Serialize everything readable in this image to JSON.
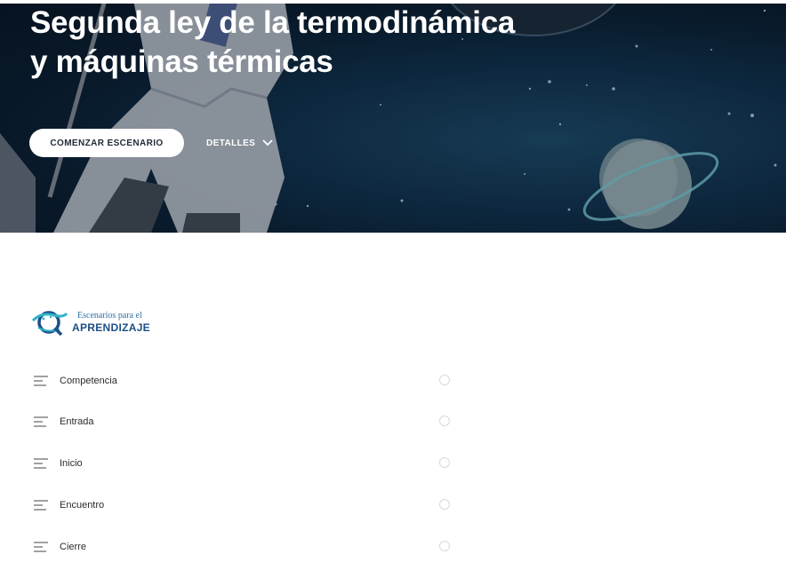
{
  "hero": {
    "title_line1": "Segunda ley de la termodinámica",
    "title_line2": "y máquinas térmicas",
    "start_button": "COMENZAR ESCENARIO",
    "details_button": "DETALLES"
  },
  "logo": {
    "line1": "Escenarios para el",
    "line2": "APRENDIZAJE"
  },
  "menu": {
    "items": [
      {
        "label": "Competencia"
      },
      {
        "label": "Entrada"
      },
      {
        "label": "Inicio"
      },
      {
        "label": "Encuentro"
      },
      {
        "label": "Cierre"
      }
    ]
  },
  "colors": {
    "hero_bg": "#0b2236",
    "button_bg": "#ffffff",
    "logo_blue": "#1d4f86",
    "logo_light": "#2f6fa5"
  }
}
